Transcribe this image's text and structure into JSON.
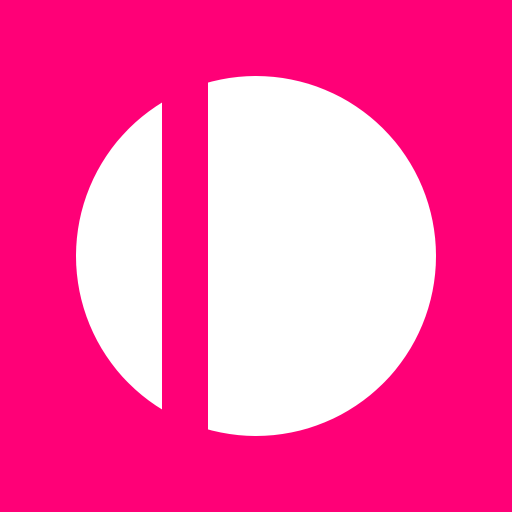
{
  "icon": {
    "name": "split-circle-logo-icon",
    "background_color": "#FF0077",
    "foreground_color": "#FFFFFF"
  }
}
